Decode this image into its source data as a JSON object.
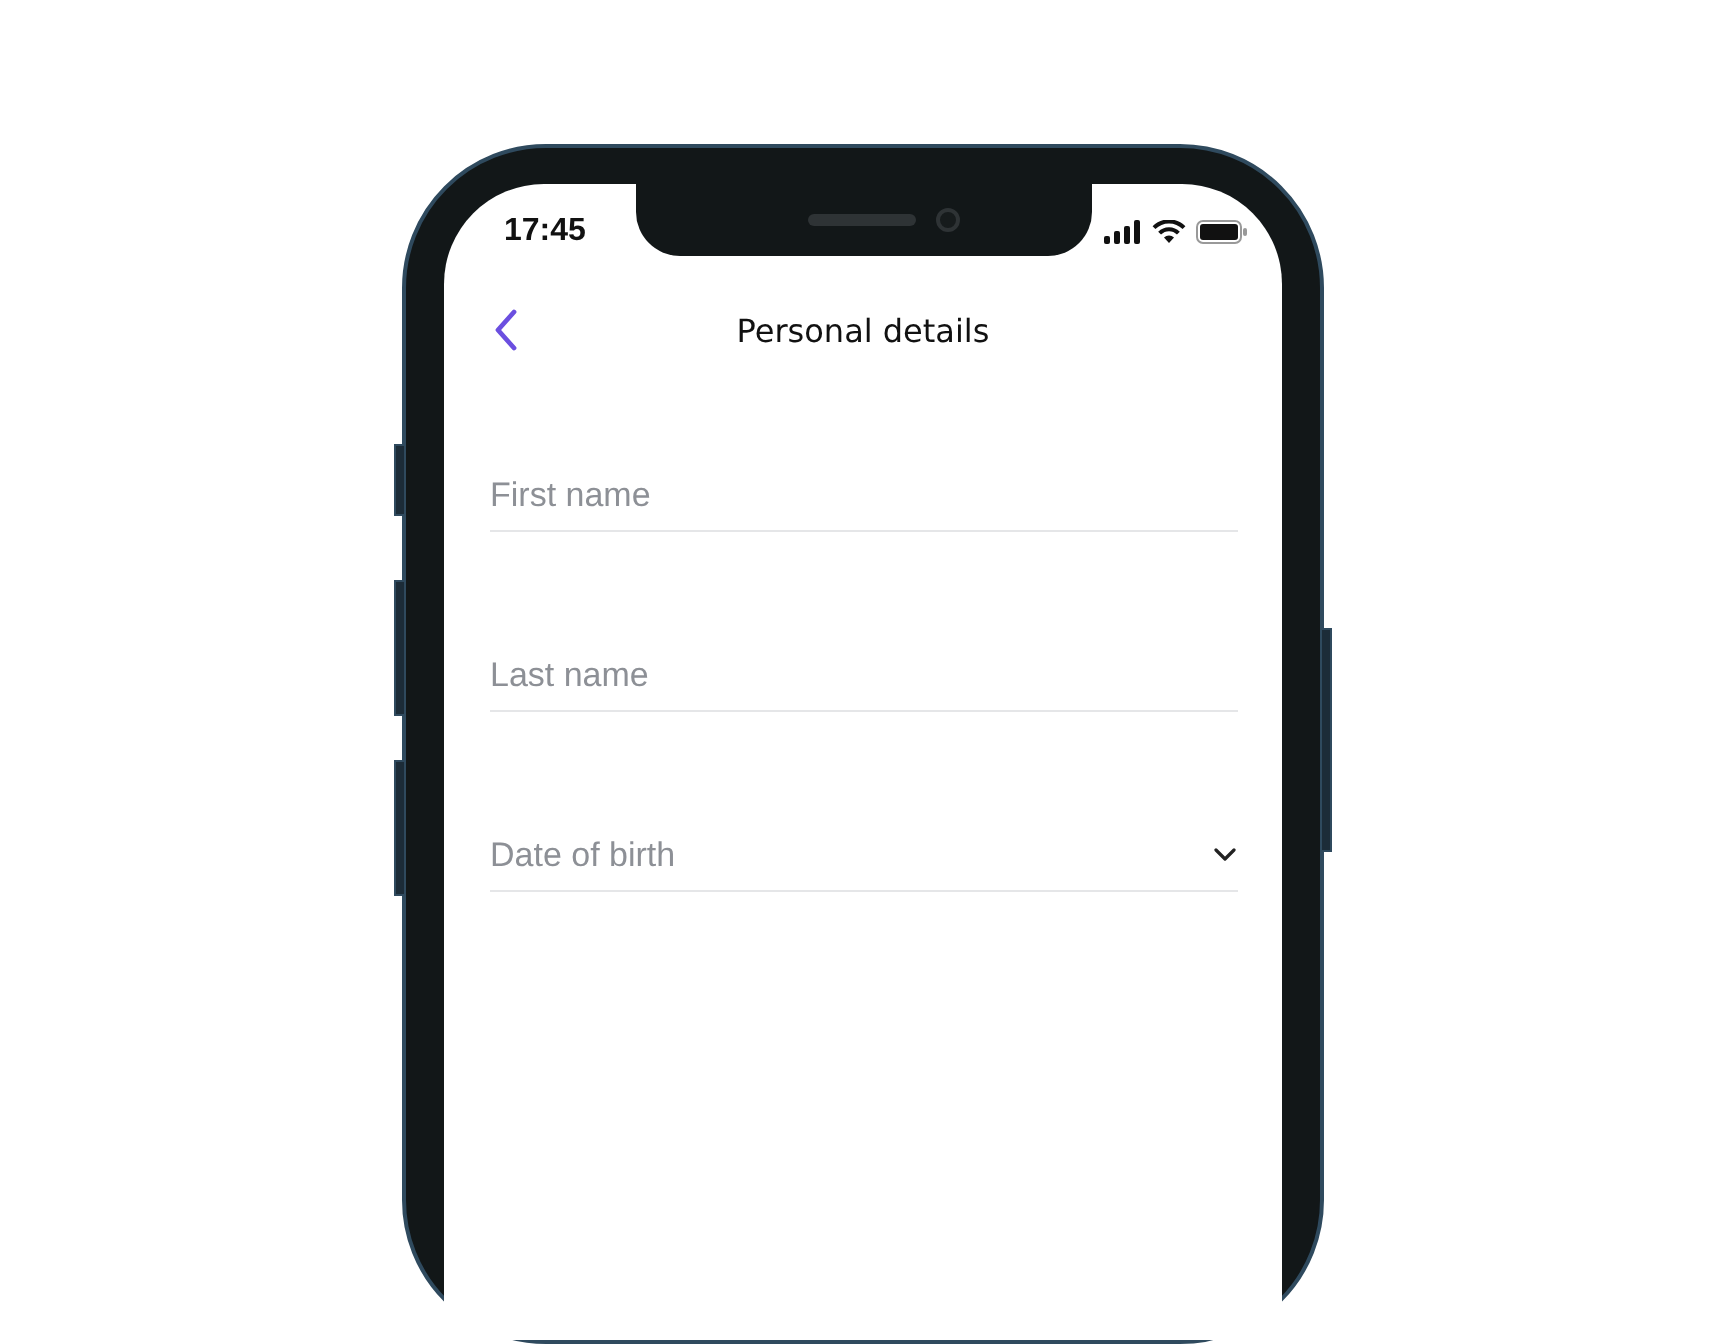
{
  "status_bar": {
    "time": "17:45"
  },
  "header": {
    "title": "Personal details"
  },
  "fields": [
    {
      "kind": "text",
      "placeholder": "First name"
    },
    {
      "kind": "text",
      "placeholder": "Last name"
    },
    {
      "kind": "select",
      "placeholder": "Date of birth"
    }
  ]
}
